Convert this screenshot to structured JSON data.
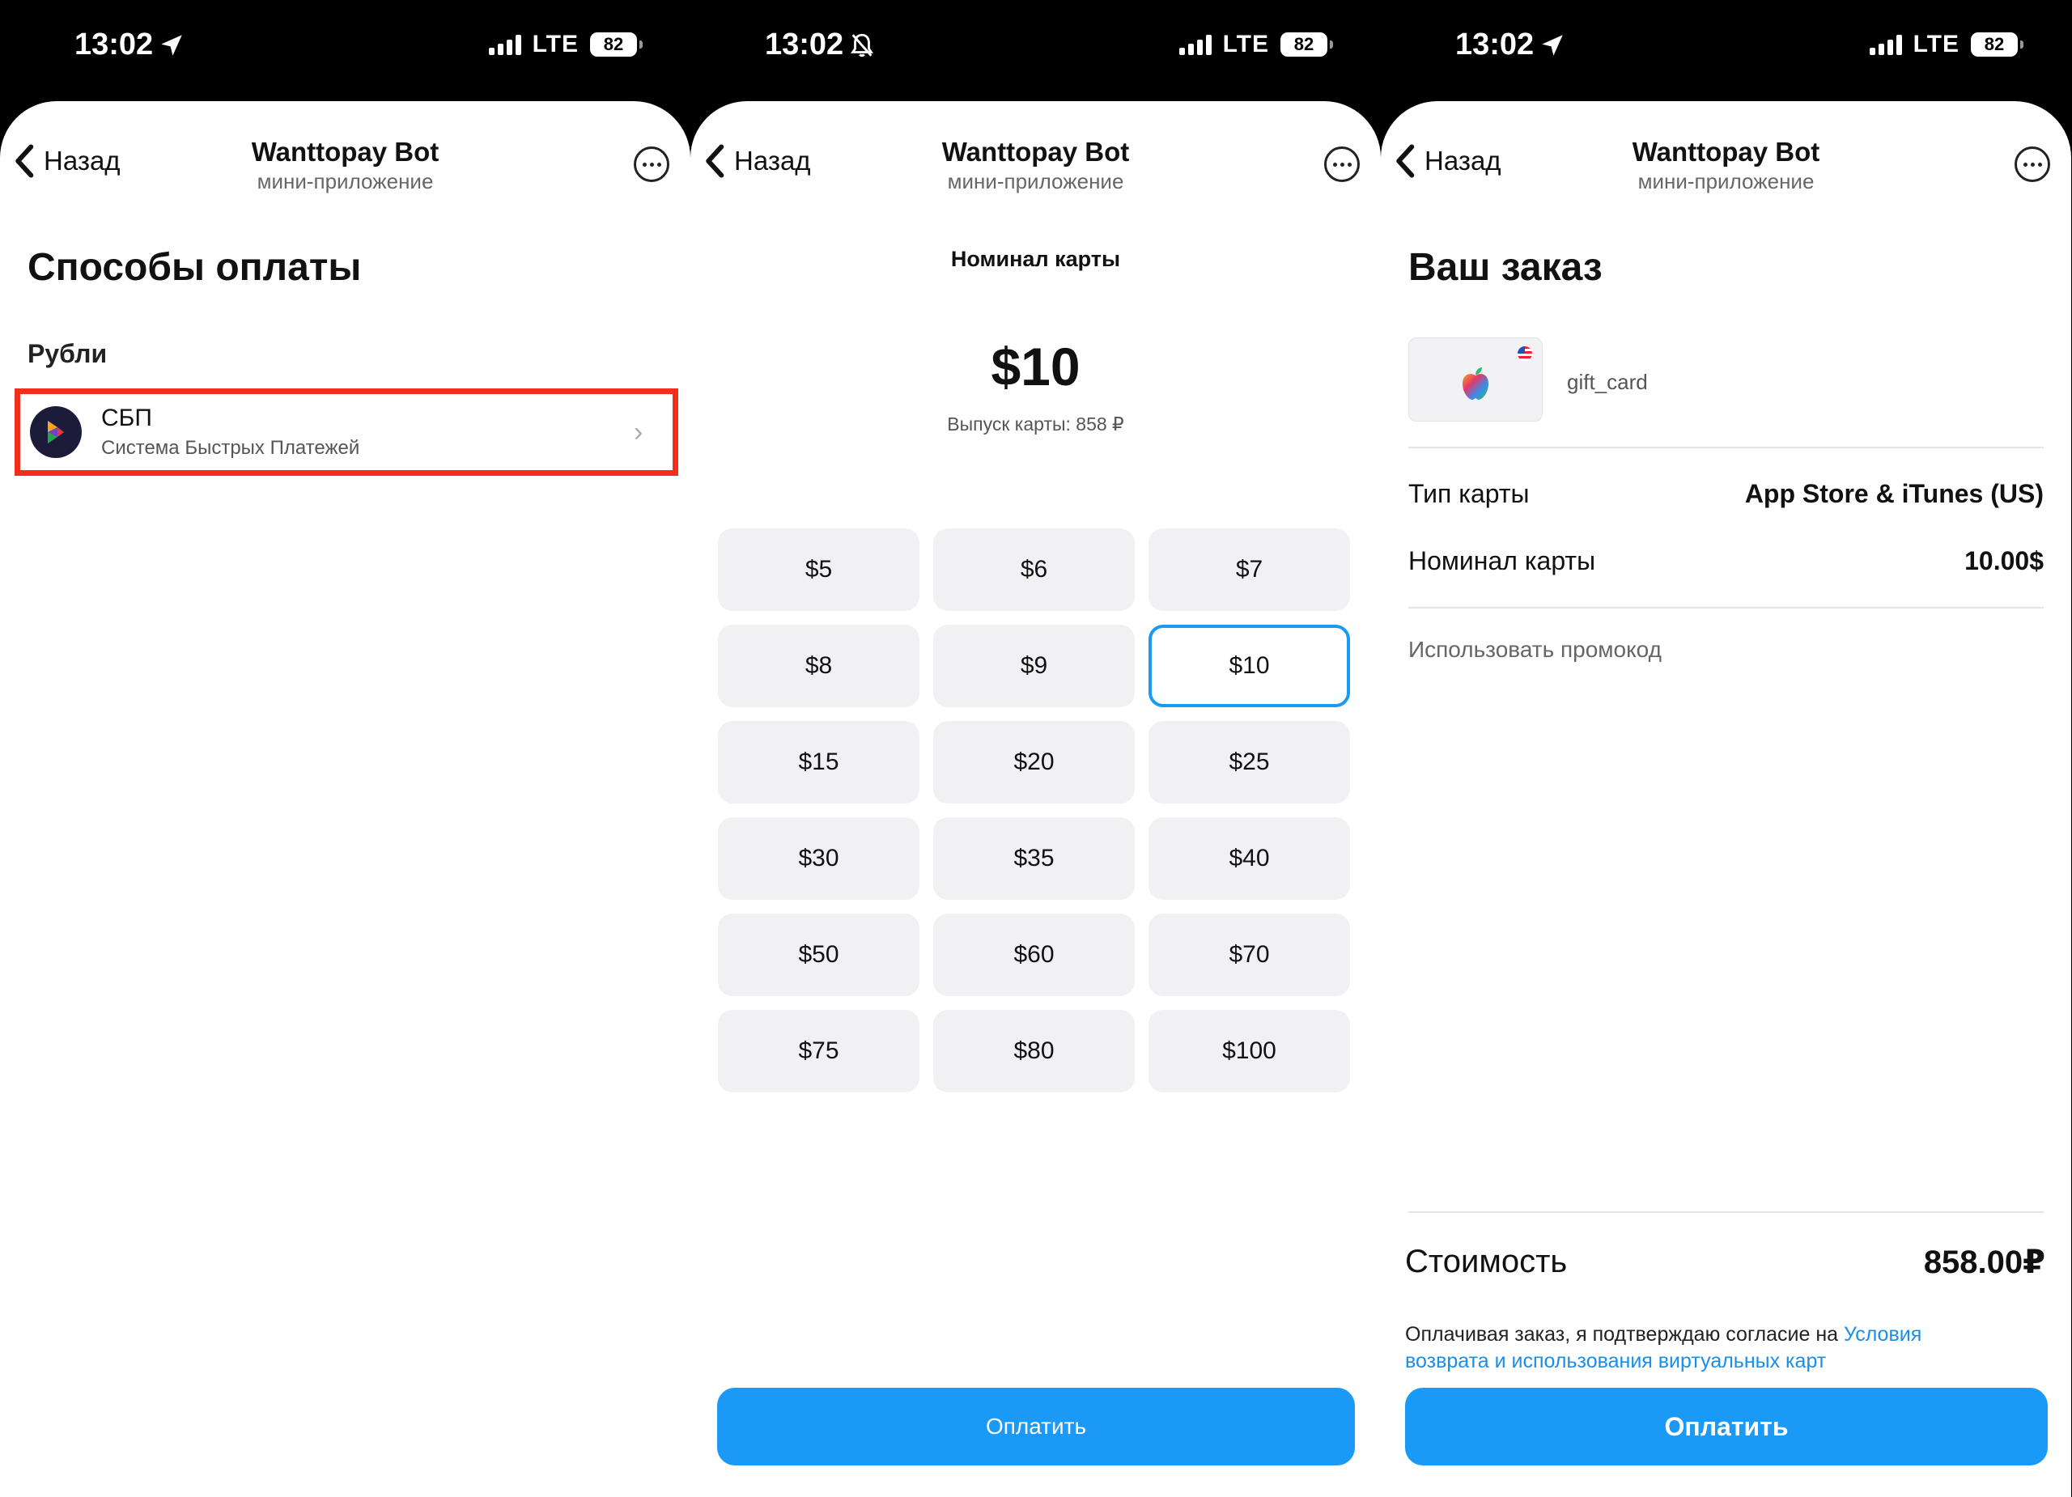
{
  "status": {
    "time": "13:02",
    "network": "LTE",
    "battery": "82"
  },
  "nav": {
    "back": "Назад",
    "title": "Wanttopay Bot",
    "subtitle": "мини-приложение"
  },
  "panel1": {
    "heading": "Способы оплаты",
    "section": "Рубли",
    "method": {
      "name": "СБП",
      "description": "Система Быстрых Платежей"
    }
  },
  "panel2": {
    "label": "Номинал карты",
    "amount": "$10",
    "issue": "Выпуск карты: 858 ₽",
    "denominations": [
      "$5",
      "$6",
      "$7",
      "$8",
      "$9",
      "$10",
      "$15",
      "$20",
      "$25",
      "$30",
      "$35",
      "$40",
      "$50",
      "$60",
      "$70",
      "$75",
      "$80",
      "$100"
    ],
    "selected": "$10",
    "pay": "Оплатить"
  },
  "panel3": {
    "heading": "Ваш заказ",
    "product_name": "gift_card",
    "card_type_label": "Тип карты",
    "card_type_value": "App Store & iTunes (US)",
    "denom_label": "Номинал карты",
    "denom_value": "10.00$",
    "promo": "Использовать промокод",
    "total_label": "Стоимость",
    "total_value": "858.00₽",
    "consent_text": "Оплачивая заказ, я подтверждаю согласие на ",
    "consent_link": "Условия возврата и использования виртуальных карт",
    "pay": "Оплатить"
  },
  "colors": {
    "accent": "#1a9af6",
    "highlight_border": "#f0301c",
    "tile_bg": "#f1f1f4"
  }
}
